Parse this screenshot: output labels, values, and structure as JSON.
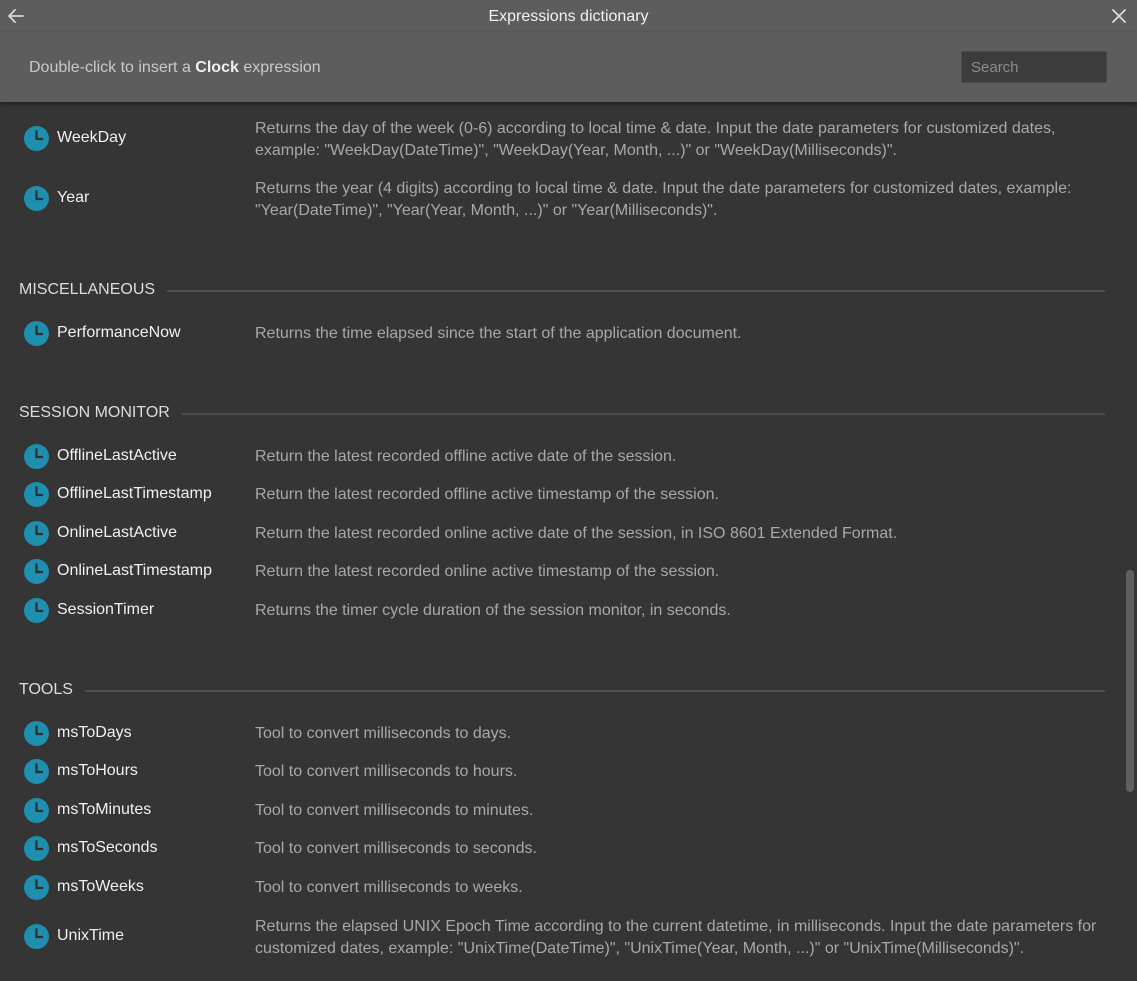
{
  "window": {
    "title": "Expressions dictionary",
    "back_icon": "arrow-left-icon",
    "close_icon": "close-icon"
  },
  "subheader": {
    "hint_prefix": "Double-click to insert a",
    "hint_bold": "Clock",
    "hint_suffix": "expression",
    "search_placeholder": "Search",
    "search_value": ""
  },
  "colors": {
    "accent_clock": "#1f8fb0",
    "background": "#353535",
    "header": "#5d5d5d"
  },
  "entries_top": [
    {
      "name": "WeekDay",
      "desc": "Returns the day of the week (0-6) according to local time & date. Input the date parameters for customized dates, example: \"WeekDay(DateTime)\", \"WeekDay(Year, Month, ...)\" or \"WeekDay(Milliseconds)\"."
    },
    {
      "name": "Year",
      "desc": "Returns the year (4 digits) according to local time & date. Input the date parameters for customized dates, example: \"Year(DateTime)\", \"Year(Year, Month, ...)\" or \"Year(Milliseconds)\"."
    }
  ],
  "sections": [
    {
      "title": "MISCELLANEOUS",
      "entries": [
        {
          "name": "PerformanceNow",
          "desc": "Returns the time elapsed since the start of the application document."
        }
      ]
    },
    {
      "title": "SESSION MONITOR",
      "entries": [
        {
          "name": "OfflineLastActive",
          "desc": "Return the latest recorded offline active date of the session."
        },
        {
          "name": "OfflineLastTimestamp",
          "desc": "Return the latest recorded offline active timestamp of the session."
        },
        {
          "name": "OnlineLastActive",
          "desc": "Return the latest recorded online active date of the session, in ISO 8601 Extended Format."
        },
        {
          "name": "OnlineLastTimestamp",
          "desc": "Return the latest recorded online active timestamp of the session."
        },
        {
          "name": "SessionTimer",
          "desc": "Returns the timer cycle duration of the session monitor, in seconds."
        }
      ]
    },
    {
      "title": "TOOLS",
      "entries": [
        {
          "name": "msToDays",
          "desc": "Tool to convert milliseconds to days."
        },
        {
          "name": "msToHours",
          "desc": "Tool to convert milliseconds to hours."
        },
        {
          "name": "msToMinutes",
          "desc": "Tool to convert milliseconds to minutes."
        },
        {
          "name": "msToSeconds",
          "desc": "Tool to convert milliseconds to seconds."
        },
        {
          "name": "msToWeeks",
          "desc": "Tool to convert milliseconds to weeks."
        },
        {
          "name": "UnixTime",
          "desc": "Returns the elapsed UNIX Epoch Time according to the current datetime, in milliseconds. Input the date parameters for customized dates, example: \"UnixTime(DateTime)\", \"UnixTime(Year, Month, ...)\" or \"UnixTime(Milliseconds)\"."
        }
      ]
    }
  ]
}
